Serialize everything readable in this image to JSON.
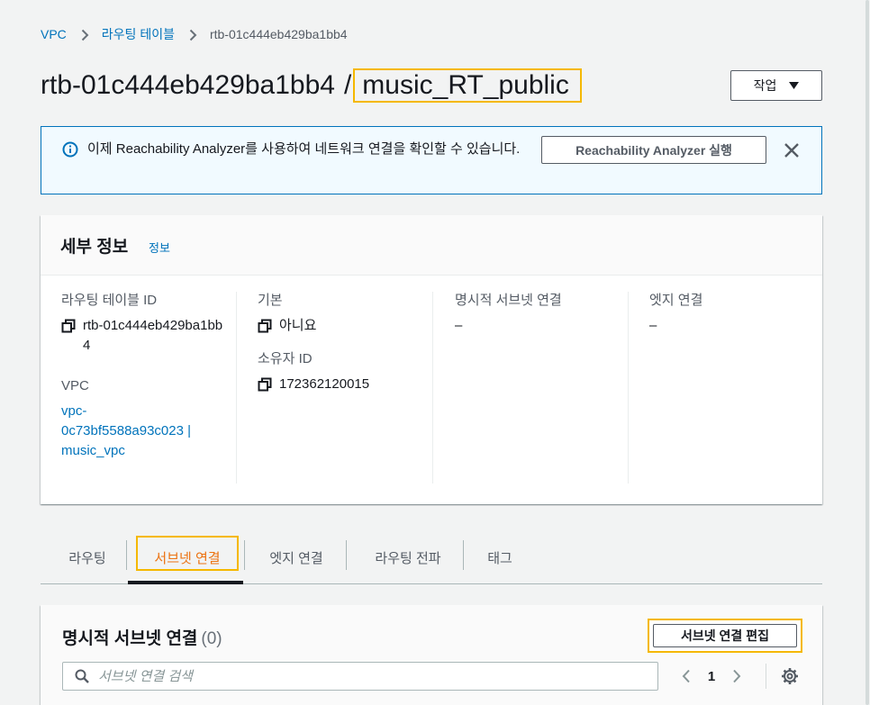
{
  "breadcrumb": {
    "items": [
      "VPC",
      "라우팅 테이블"
    ],
    "current": "rtb-01c444eb429ba1bb4"
  },
  "header": {
    "title_id": "rtb-01c444eb429ba1bb4",
    "title_sep": "/",
    "title_name": "music_RT_public",
    "actions_label": "작업"
  },
  "banner": {
    "text": "이제 Reachability Analyzer를 사용하여 네트워크 연결을 확인할 수 있습니다.",
    "button_label": "Reachability Analyzer 실행"
  },
  "details": {
    "title": "세부 정보",
    "info_link": "정보",
    "route_table_id_label": "라우팅 테이블 ID",
    "route_table_id_value": "rtb-01c444eb429ba1bb4",
    "vpc_label": "VPC",
    "vpc_value_line1": "vpc-",
    "vpc_value_line2": "0c73bf5588a93c023 |",
    "vpc_value_line3": "music_vpc",
    "main_label": "기본",
    "main_value": "아니요",
    "owner_label": "소유자 ID",
    "owner_value": "172362120015",
    "explicit_subnet_label": "명시적 서브넷 연결",
    "explicit_subnet_value": "–",
    "edge_label": "엣지 연결",
    "edge_value": "–"
  },
  "tabs": [
    "라우팅",
    "서브넷 연결",
    "엣지 연결",
    "라우팅 전파",
    "태그"
  ],
  "active_tab_index": 1,
  "subnets_panel": {
    "title": "명시적 서브넷 연결",
    "count": "(0)",
    "edit_button_label": "서브넷 연결 편집",
    "search_placeholder": "서브넷 연결 검색",
    "page_number": "1"
  },
  "colors": {
    "link": "#0073bb",
    "highlight": "#f5b800",
    "active_tab": "#ec7211"
  }
}
